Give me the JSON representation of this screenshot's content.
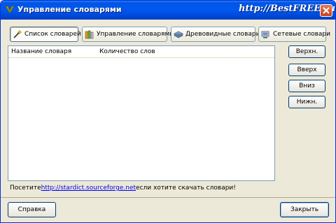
{
  "window": {
    "title": "Управление словарями",
    "watermark": "http://BestFREE.ru"
  },
  "tabs": [
    {
      "label": "Список словарей",
      "icon": "wand-icon",
      "active": true
    },
    {
      "label": "Управление словарями",
      "icon": "books-icon",
      "active": false
    },
    {
      "label": "Древовидные словари",
      "icon": "tree-book-icon",
      "active": false
    },
    {
      "label": "Сетевые словари",
      "icon": "network-icon",
      "active": false
    }
  ],
  "list": {
    "columns": [
      "Название словаря",
      "Количество слов"
    ],
    "rows": []
  },
  "side_buttons": {
    "top": "Верхн.",
    "up": "Вверх",
    "down": "Вниз",
    "bottom": "Нижн."
  },
  "visit": {
    "prefix": "Посетите",
    "url": "http://stardict.sourceforge.net",
    "suffix": "если хотите скачать словари!"
  },
  "buttons": {
    "help": "Справка",
    "close": "Закрыть"
  },
  "colors": {
    "titlebar": "#0058ee",
    "face": "#ece9d8",
    "close_button": "#c8401e",
    "link": "#0000ee"
  }
}
